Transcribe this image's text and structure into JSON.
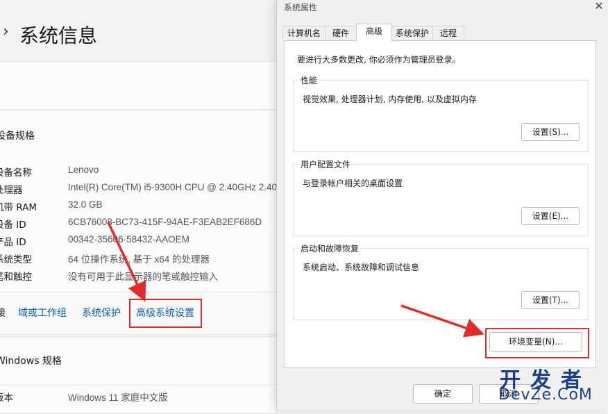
{
  "settings": {
    "breadcrumb_chevron": "›",
    "title": "系统信息",
    "device_section_title": "设备规格",
    "specs": [
      {
        "key": "设备名称",
        "value": "Lenovo"
      },
      {
        "key": "处理器",
        "value": "Intel(R) Core(TM) i5-9300H CPU @ 2.40GHz   2.40"
      },
      {
        "key": "机带 RAM",
        "value": "32.0 GB"
      },
      {
        "key": "设备 ID",
        "value": "6CB76008-BC73-415F-94AE-F3EAB2EF686D"
      },
      {
        "key": "产品 ID",
        "value": "00342-35606-58432-AAOEM"
      },
      {
        "key": "系统类型",
        "value": "64 位操作系统, 基于 x64 的处理器"
      },
      {
        "key": "笔和触控",
        "value": "没有可用于此显示器的笔或触控输入"
      }
    ],
    "related_links": [
      "域或工作组",
      "系统保护",
      "高级系统设置"
    ],
    "related_prefix": "接",
    "windows_section_title": "Windows 规格",
    "windows_specs": [
      {
        "key": "版本",
        "value": "Windows 11 家庭中文版"
      }
    ]
  },
  "dialog": {
    "title": "系统属性",
    "close_glyph": "✕",
    "tabs": [
      "计算机名",
      "硬件",
      "高级",
      "系统保护",
      "远程"
    ],
    "active_tab": "高级",
    "notice": "要进行大多数更改, 你必须作为管理员登录。",
    "groups": [
      {
        "label": "性能",
        "desc": "视觉效果, 处理器计划, 内存使用, 以及虚拟内存",
        "button": "设置(S)..."
      },
      {
        "label": "用户配置文件",
        "desc": "与登录帐户相关的桌面设置",
        "button": "设置(E)..."
      },
      {
        "label": "启动和故障恢复",
        "desc": "系统启动、系统故障和调试信息",
        "button": "设置(T)..."
      }
    ],
    "env_button": "环境变量(N)...",
    "ok_button": "确定",
    "cancel_button": "取消"
  },
  "watermark": {
    "top": "开发者",
    "bottom": "DevZe.CoM"
  },
  "colors": {
    "highlight": "#e22b2b",
    "link": "#0b5cad",
    "watermark": "#1f3e8a"
  }
}
